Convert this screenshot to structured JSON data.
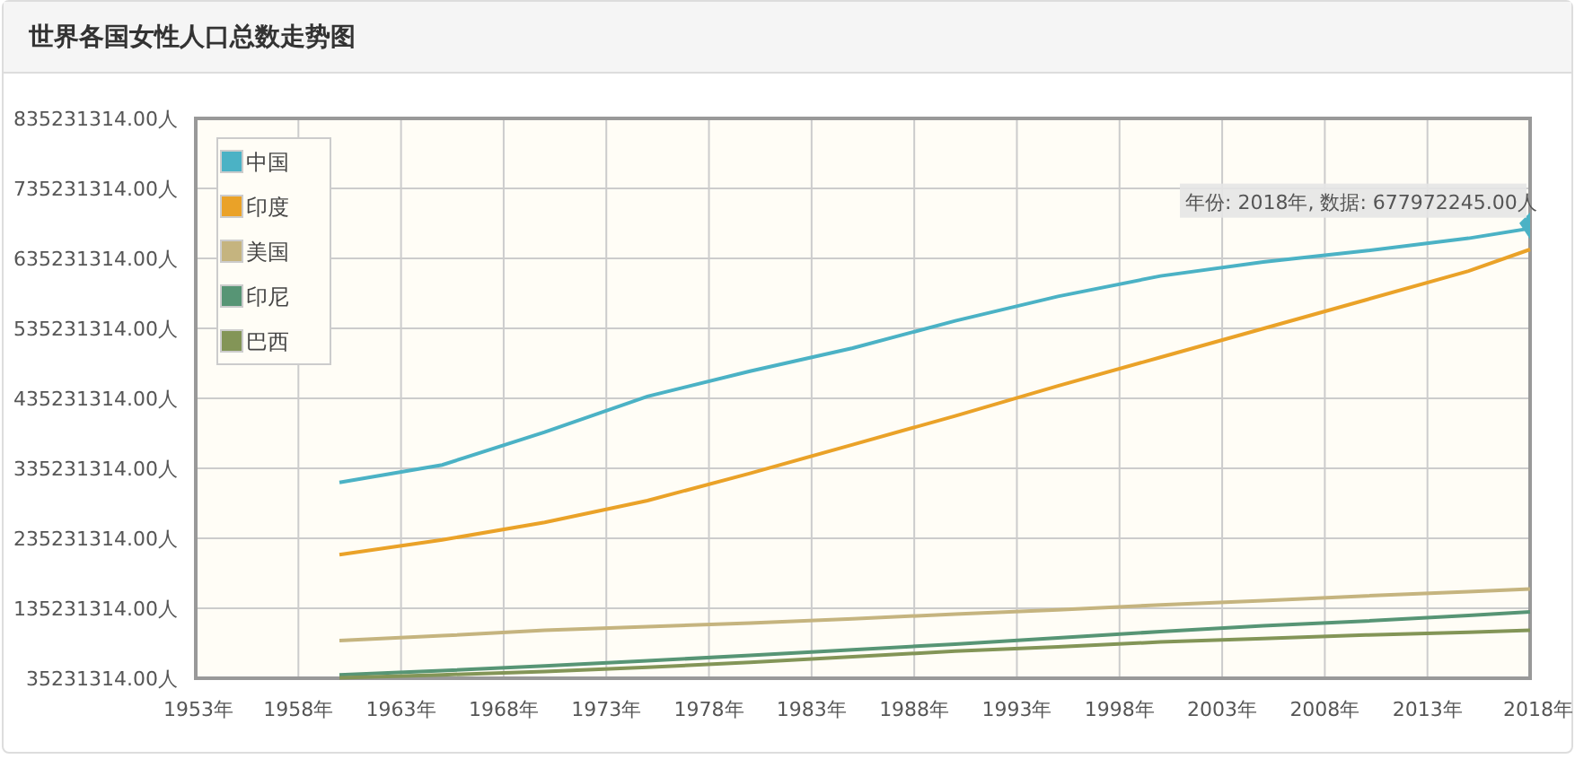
{
  "card": {
    "title": "世界各国女性人口总数走势图"
  },
  "chart_data": {
    "type": "line",
    "x": [
      1960,
      1965,
      1970,
      1975,
      1980,
      1985,
      1990,
      1995,
      2000,
      2005,
      2010,
      2015,
      2018
    ],
    "series": [
      {
        "name": "中国",
        "color": "#4bb2c5",
        "values": [
          315000000,
          340000000,
          387000000,
          438000000,
          474000000,
          507000000,
          546000000,
          581000000,
          610000000,
          630000000,
          646000000,
          664000000,
          678000000
        ]
      },
      {
        "name": "印度",
        "color": "#eaa228",
        "values": [
          212000000,
          233000000,
          258000000,
          289000000,
          328000000,
          369000000,
          410000000,
          453000000,
          494000000,
          535000000,
          576000000,
          617000000,
          648000000
        ]
      },
      {
        "name": "美国",
        "color": "#c5b47f",
        "values": [
          89000000,
          96000000,
          104000000,
          109000000,
          114000000,
          120000000,
          127000000,
          133000000,
          140000000,
          146000000,
          153000000,
          159000000,
          163000000
        ]
      },
      {
        "name": "印尼",
        "color": "#579575",
        "values": [
          40000000,
          46000000,
          53000000,
          60000000,
          68000000,
          76000000,
          84000000,
          93000000,
          102000000,
          110000000,
          117000000,
          125000000,
          130000000
        ]
      },
      {
        "name": "巴西",
        "color": "#839557",
        "values": [
          36000000,
          40000000,
          45000000,
          51000000,
          58000000,
          66000000,
          74000000,
          80000000,
          87000000,
          92000000,
          97000000,
          101000000,
          104000000
        ]
      }
    ],
    "grid": true,
    "legend": true,
    "xlim": [
      1953,
      2018
    ],
    "ylim": [
      35231314,
      835231314
    ],
    "xticks": [
      {
        "value": 1953,
        "label": "1953年"
      },
      {
        "value": 1958,
        "label": "1958年"
      },
      {
        "value": 1963,
        "label": "1963年"
      },
      {
        "value": 1968,
        "label": "1968年"
      },
      {
        "value": 1973,
        "label": "1973年"
      },
      {
        "value": 1978,
        "label": "1978年"
      },
      {
        "value": 1983,
        "label": "1983年"
      },
      {
        "value": 1988,
        "label": "1988年"
      },
      {
        "value": 1993,
        "label": "1993年"
      },
      {
        "value": 1998,
        "label": "1998年"
      },
      {
        "value": 2003,
        "label": "2003年"
      },
      {
        "value": 2008,
        "label": "2008年"
      },
      {
        "value": 2013,
        "label": "2013年"
      },
      {
        "value": 2018,
        "label": "2018年"
      }
    ],
    "yticks": [
      {
        "value": 35231314,
        "label": "35231314.00人"
      },
      {
        "value": 135231314,
        "label": "135231314.00人"
      },
      {
        "value": 235231314,
        "label": "235231314.00人"
      },
      {
        "value": 335231314,
        "label": "335231314.00人"
      },
      {
        "value": 435231314,
        "label": "435231314.00人"
      },
      {
        "value": 535231314,
        "label": "535231314.00人"
      },
      {
        "value": 635231314,
        "label": "635231314.00人"
      },
      {
        "value": 735231314,
        "label": "735231314.00人"
      },
      {
        "value": 835231314,
        "label": "835231314.00人"
      }
    ],
    "annotations": [
      {
        "text": "年份: 2018年, 数据: 677972245.00人",
        "x": 2018,
        "y": 677972245
      }
    ]
  }
}
